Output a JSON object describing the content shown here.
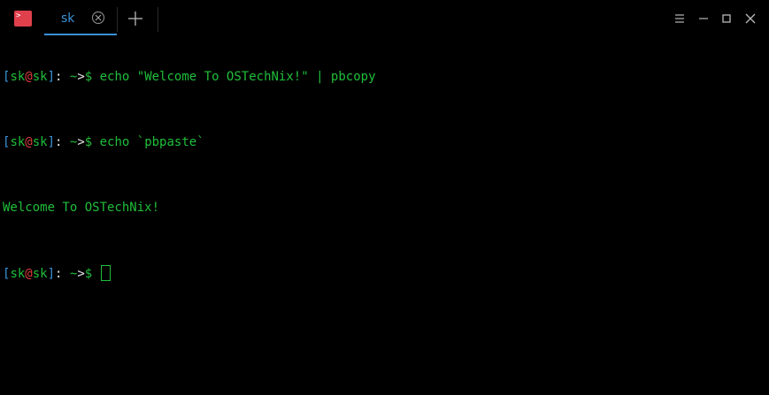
{
  "titlebar": {
    "app_icon": "terminal-app-icon",
    "app_icon_glyph_top": ">",
    "app_icon_glyph_bottom": "_",
    "tabs": [
      {
        "label": "sk",
        "active": true,
        "close_icon": "close-circle-icon"
      }
    ],
    "new_tab_icon": "plus-icon",
    "window_controls": [
      "menu-icon",
      "minimize-icon",
      "maximize-icon",
      "close-icon"
    ]
  },
  "colors": {
    "background": "#000000",
    "accent_blue": "#3a94d9",
    "prompt_green": "#1fbf3a",
    "command_text": "#e8e8e8",
    "tilde_red": "#e23b3b",
    "app_icon_red": "#e0404c"
  },
  "terminal": {
    "prompt": {
      "open_bracket": "[",
      "user": "sk",
      "at": "@",
      "host": "sk",
      "close_bracket": "]",
      "separator": ": ",
      "tilde": "~",
      "arrow": ">",
      "dollar": "$"
    },
    "lines": [
      {
        "type": "command",
        "text": " echo \"Welcome To OSTechNix!\" | pbcopy"
      },
      {
        "type": "command",
        "text": " echo `pbpaste`"
      },
      {
        "type": "output",
        "text": "Welcome To OSTechNix!"
      },
      {
        "type": "command",
        "text": " "
      }
    ]
  }
}
